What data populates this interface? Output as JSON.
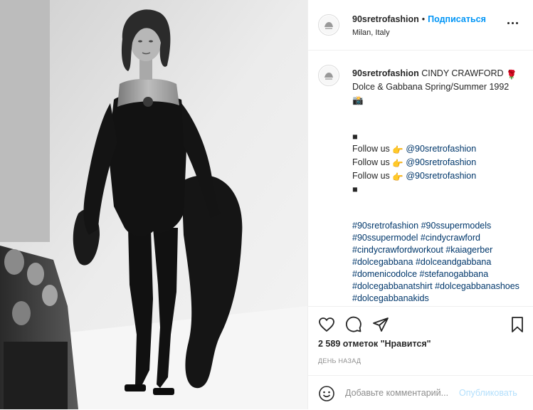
{
  "header": {
    "username": "90sretrofashion",
    "separator": "•",
    "follow_label": "Подписаться",
    "location": "Milan, Italy",
    "avatar_icon": "account-avatar-icon",
    "more_icon": "more-options-icon"
  },
  "caption": {
    "username": "90sretrofashion",
    "title_line1": "CINDY CRAWFORD",
    "rose_emoji": "🌹",
    "title_line2": "Dolce & Gabbana Spring/Summer 1992",
    "camera_emoji": "📸",
    "block_char": "■",
    "follow_lines": [
      {
        "prefix": "Follow us",
        "emoji": "👉",
        "handle": "@90sretrofashion"
      },
      {
        "prefix": "Follow us",
        "emoji": "👉",
        "handle": "@90sretrofashion"
      },
      {
        "prefix": "Follow us",
        "emoji": "👉",
        "handle": "@90sretrofashion"
      }
    ],
    "hashtags": [
      "#90sretrofashion",
      "#90ssupermodels",
      "#90ssupermodel",
      "#cindycrawford",
      "#cindycrawfordworkout",
      "#kaiagerber",
      "#dolcegabbana",
      "#dolceandgabbana",
      "#domenicodolce",
      "#stefanogabbana",
      "#dolcegabbanatshirt",
      "#dolcegabbanashoes",
      "#dolcegabbanakids"
    ]
  },
  "actions": {
    "like_icon": "heart-icon",
    "comment_icon": "comment-icon",
    "share_icon": "share-icon",
    "save_icon": "bookmark-icon",
    "likes_count": "2 589",
    "likes_text": "отметок \"Нравится\"",
    "timestamp": "ДЕНЬ НАЗАД"
  },
  "comment": {
    "emoji_icon": "smile-icon",
    "placeholder": "Добавьте комментарий...",
    "publish_label": "Опубликовать"
  },
  "colors": {
    "accent": "#0095f6",
    "link": "#00376b",
    "publish_disabled": "#b2dffc",
    "text": "#262626",
    "muted": "#8e8e8e",
    "border": "#efefef"
  }
}
